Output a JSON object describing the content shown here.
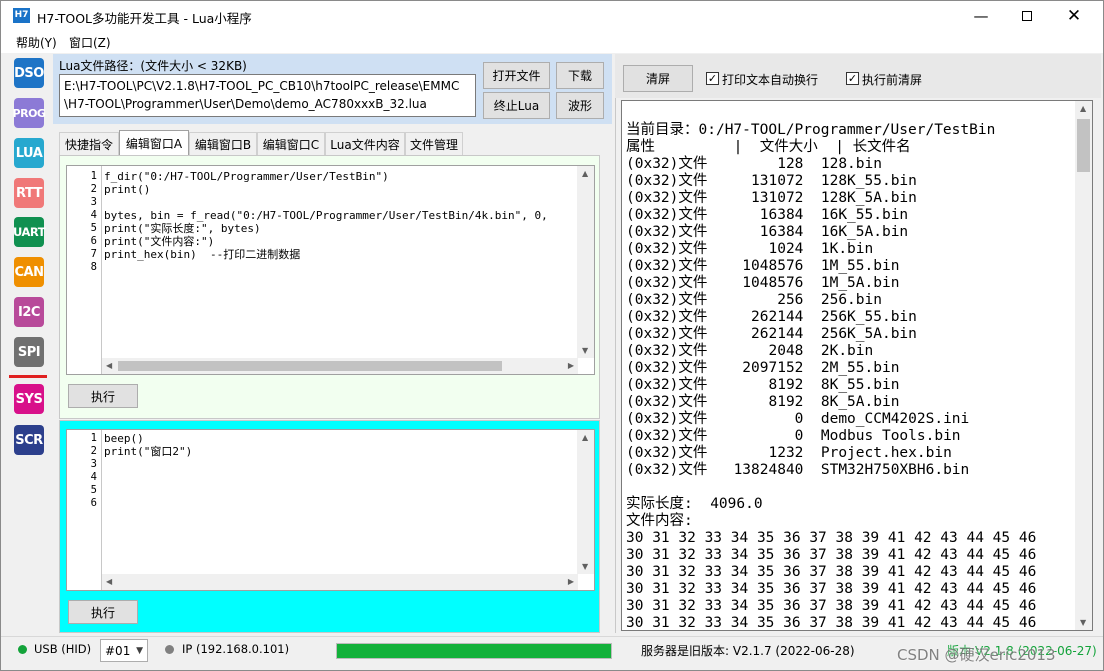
{
  "window": {
    "icon": "H7",
    "title": "H7-TOOL多功能开发工具 - Lua小程序"
  },
  "menu": [
    {
      "label": "帮助(Y)"
    },
    {
      "label": "窗口(Z)"
    }
  ],
  "rail": [
    {
      "label": "DSO",
      "color": "#1e74c6"
    },
    {
      "label": "PROG",
      "color": "#8c7ad6"
    },
    {
      "label": "LUA",
      "color": "#27a8cf"
    },
    {
      "label": "RTT",
      "color": "#f07878"
    },
    {
      "label": "UART",
      "color": "#109050"
    },
    {
      "label": "CAN",
      "color": "#ef8f00"
    },
    {
      "label": "I2C",
      "color": "#b84a9a"
    },
    {
      "label": "SPI",
      "color": "#707070"
    },
    {
      "label": "SYS",
      "color": "#d8108a"
    },
    {
      "label": "SCR",
      "color": "#2c3f8c"
    }
  ],
  "lua_path": {
    "label": "Lua文件路径：(文件大小 < 32KB)",
    "line1": "E:\\H7-TOOL\\PC\\V2.1.8\\H7-TOOL_PC_CB10\\h7toolPC_release\\EMMC",
    "line2": "\\H7-TOOL\\Programmer\\User\\Demo\\demo_AC780xxxB_32.lua"
  },
  "buttons": {
    "open_file": "打开文件",
    "download": "下载",
    "stop_lua": "终止Lua",
    "waveform": "波形",
    "execute_a": "执行",
    "execute_b": "执行",
    "clear": "清屏"
  },
  "tabs": [
    {
      "label": "快捷指令"
    },
    {
      "label": "编辑窗口A"
    },
    {
      "label": "编辑窗口B"
    },
    {
      "label": "编辑窗口C"
    },
    {
      "label": "Lua文件内容"
    },
    {
      "label": "文件管理"
    }
  ],
  "active_tab": 1,
  "editor_a": {
    "line_numbers": [
      "1",
      "2",
      "3",
      "4",
      "5",
      "6",
      "7",
      "8"
    ],
    "lines": [
      "f_dir(\"0:/H7-TOOL/Programmer/User/TestBin\")",
      "print()",
      "",
      "bytes, bin = f_read(\"0:/H7-TOOL/Programmer/User/TestBin/4k.bin\", 0,",
      "print(\"实际长度:\", bytes)",
      "print(\"文件内容:\")",
      "print_hex(bin)  --打印二进制数据",
      ""
    ]
  },
  "editor_b": {
    "line_numbers": [
      "1",
      "2",
      "3",
      "4",
      "5",
      "6"
    ],
    "lines": [
      "beep()",
      "print(\"窗口2\")",
      "",
      "",
      "",
      ""
    ]
  },
  "options": {
    "auto_wrap_label": "打印文本自动换行",
    "auto_wrap_checked": true,
    "clear_before_exec_label": "执行前清屏",
    "clear_before_exec_checked": true
  },
  "console_lines": [
    "",
    "当前目录：0:/H7-TOOL/Programmer/User/TestBin",
    "属性         |  文件大小  | 长文件名",
    "(0x32)文件        128  128.bin",
    "(0x32)文件     131072  128K_55.bin",
    "(0x32)文件     131072  128K_5A.bin",
    "(0x32)文件      16384  16K_55.bin",
    "(0x32)文件      16384  16K_5A.bin",
    "(0x32)文件       1024  1K.bin",
    "(0x32)文件    1048576  1M_55.bin",
    "(0x32)文件    1048576  1M_5A.bin",
    "(0x32)文件        256  256.bin",
    "(0x32)文件     262144  256K_55.bin",
    "(0x32)文件     262144  256K_5A.bin",
    "(0x32)文件       2048  2K.bin",
    "(0x32)文件    2097152  2M_55.bin",
    "(0x32)文件       8192  8K_55.bin",
    "(0x32)文件       8192  8K_5A.bin",
    "(0x32)文件          0  demo_CCM4202S.ini",
    "(0x32)文件          0  Modbus Tools.bin",
    "(0x32)文件       1232  Project.hex.bin",
    "(0x32)文件   13824840  STM32H750XBH6.bin",
    "",
    "实际长度:  4096.0",
    "文件内容:",
    "30 31 32 33 34 35 36 37 38 39 41 42 43 44 45 46",
    "30 31 32 33 34 35 36 37 38 39 41 42 43 44 45 46",
    "30 31 32 33 34 35 36 37 38 39 41 42 43 44 45 46",
    "30 31 32 33 34 35 36 37 38 39 41 42 43 44 45 46",
    "30 31 32 33 34 35 36 37 38 39 41 42 43 44 45 46",
    "30 31 32 33 34 35 36 37 38 39 41 42 43 44 45 46"
  ],
  "status": {
    "usb_label": "USB (HID)",
    "usb_color": "#13a33a",
    "device_select": "#01",
    "ip_label": "IP (192.168.0.101)",
    "ip_color": "#808080",
    "progress": 1.0,
    "progress_color": "#13b13a",
    "server_version": "服务器是旧版本: V2.1.7 (2022-06-28)",
    "local_version": "版本:V2.1.8 (2022-06-27)",
    "watermark": "CSDN @硬汉eric2013"
  }
}
